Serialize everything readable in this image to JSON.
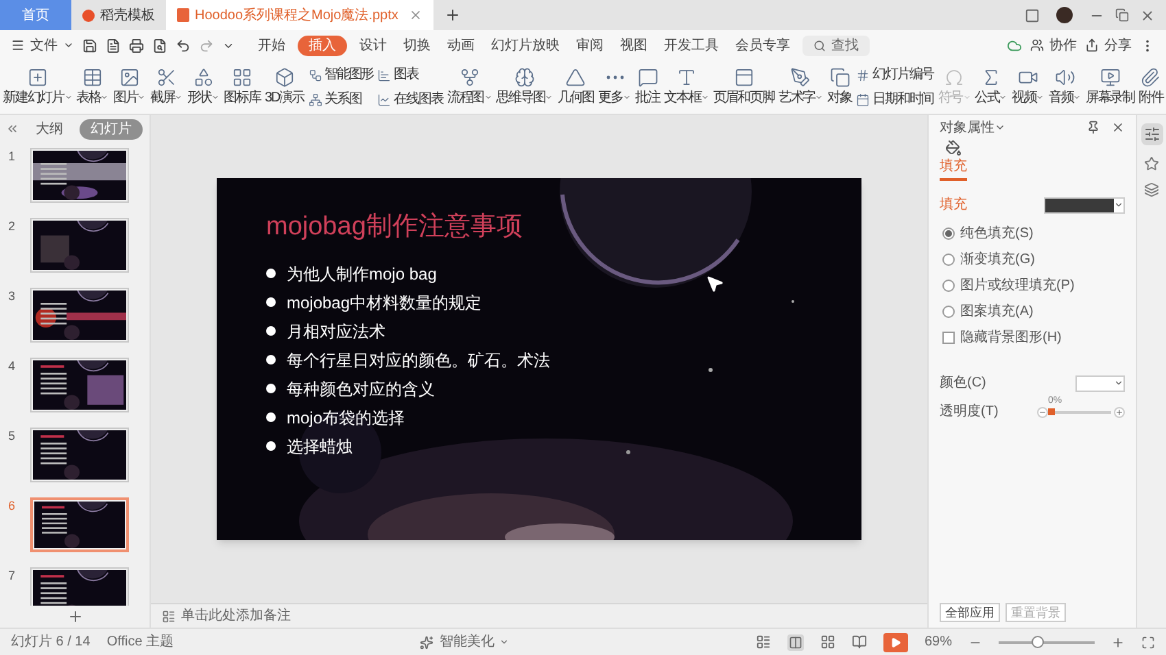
{
  "tabs": [
    {
      "label": "首页",
      "kind": "home",
      "selected": false
    },
    {
      "label": "稻壳模板",
      "kind": "template",
      "selected": false
    },
    {
      "label": "Hoodoo系列课程之Mojo魔法.pptx",
      "kind": "document",
      "selected": true
    }
  ],
  "menu": {
    "file": "文件",
    "items": [
      {
        "label": "开始",
        "selected": false
      },
      {
        "label": "插入",
        "selected": true
      },
      {
        "label": "设计",
        "selected": false
      },
      {
        "label": "切换",
        "selected": false
      },
      {
        "label": "动画",
        "selected": false
      },
      {
        "label": "幻灯片放映",
        "selected": false
      },
      {
        "label": "审阅",
        "selected": false
      },
      {
        "label": "视图",
        "selected": false
      },
      {
        "label": "开发工具",
        "selected": false
      },
      {
        "label": "会员专享",
        "selected": false
      }
    ],
    "search": "查找",
    "right": [
      "协作",
      "分享"
    ]
  },
  "ribbon": [
    {
      "kind": "large",
      "label": "新建幻灯片",
      "dropdown": true,
      "disabled": false
    },
    {
      "kind": "large",
      "label": "表格",
      "dropdown": true,
      "disabled": false
    },
    {
      "kind": "large",
      "label": "图片",
      "dropdown": true,
      "disabled": false
    },
    {
      "kind": "large",
      "label": "截屏",
      "dropdown": true,
      "disabled": false
    },
    {
      "kind": "large",
      "label": "形状",
      "dropdown": true,
      "disabled": false
    },
    {
      "kind": "large",
      "label": "图标库",
      "dropdown": false,
      "disabled": false
    },
    {
      "kind": "large",
      "label": "3D演示",
      "dropdown": false,
      "disabled": false
    },
    {
      "kind": "pair",
      "rows": [
        {
          "label": "智能图形"
        },
        {
          "label": "关系图"
        }
      ]
    },
    {
      "kind": "pair",
      "rows": [
        {
          "label": "图表"
        },
        {
          "label": "在线图表"
        }
      ]
    },
    {
      "kind": "large",
      "label": "流程图",
      "dropdown": true,
      "disabled": false
    },
    {
      "kind": "large",
      "label": "思维导图",
      "dropdown": true,
      "disabled": false
    },
    {
      "kind": "large",
      "label": "几何图",
      "dropdown": false,
      "disabled": false
    },
    {
      "kind": "large",
      "label": "更多",
      "dropdown": true,
      "disabled": false
    },
    {
      "kind": "large",
      "label": "批注",
      "dropdown": false,
      "disabled": false
    },
    {
      "kind": "large",
      "label": "文本框",
      "dropdown": true,
      "disabled": false
    },
    {
      "kind": "large",
      "label": "页眉和页脚",
      "dropdown": false,
      "disabled": false
    },
    {
      "kind": "large",
      "label": "艺术字",
      "dropdown": true,
      "disabled": false
    },
    {
      "kind": "large",
      "label": "对象",
      "dropdown": false,
      "disabled": false
    },
    {
      "kind": "pair",
      "rows": [
        {
          "label": "幻灯片编号"
        },
        {
          "label": "日期和时间"
        }
      ]
    },
    {
      "kind": "large",
      "label": "符号",
      "dropdown": true,
      "disabled": true
    },
    {
      "kind": "large",
      "label": "公式",
      "dropdown": true,
      "disabled": false
    },
    {
      "kind": "large",
      "label": "视频",
      "dropdown": true,
      "disabled": false
    },
    {
      "kind": "large",
      "label": "音频",
      "dropdown": true,
      "disabled": false
    },
    {
      "kind": "large",
      "label": "屏幕录制",
      "dropdown": false,
      "disabled": false
    },
    {
      "kind": "large",
      "label": "附件",
      "dropdown": false,
      "disabled": false
    }
  ],
  "outline_tabs": [
    {
      "label": "大纲",
      "selected": false
    },
    {
      "label": "幻灯片",
      "selected": true
    }
  ],
  "thumbnails": [
    {
      "number": "1",
      "selected": false,
      "kind": "picture"
    },
    {
      "number": "2",
      "selected": false,
      "kind": "picture"
    },
    {
      "number": "3",
      "selected": false,
      "kind": "picture"
    },
    {
      "number": "4",
      "selected": false,
      "kind": "picture"
    },
    {
      "number": "5",
      "selected": false,
      "kind": "picture"
    },
    {
      "number": "6",
      "selected": true,
      "kind": "picture"
    },
    {
      "number": "7",
      "selected": false,
      "kind": "picture"
    }
  ],
  "slide": {
    "title": "mojobag制作注意事项",
    "bullets": [
      "为他人制作mojo bag",
      "mojobag中材料数量的规定",
      "月相对应法术",
      "每个行星日对应的颜色。矿石。术法",
      "每种颜色对应的含义",
      "mojo布袋的选择",
      "选择蜡烛"
    ]
  },
  "notes_placeholder": "单击此处添加备注",
  "panel": {
    "title": "对象属性",
    "tab": "填充",
    "section": "填充",
    "options": [
      {
        "label": "纯色填充(S)",
        "kind": "radio",
        "selected": true
      },
      {
        "label": "渐变填充(G)",
        "kind": "radio",
        "selected": false
      },
      {
        "label": "图片或纹理填充(P)",
        "kind": "radio",
        "selected": false
      },
      {
        "label": "图案填充(A)",
        "kind": "radio",
        "selected": false
      },
      {
        "label": "隐藏背景图形(H)",
        "kind": "checkbox",
        "checked": false
      }
    ],
    "color_label": "颜色(C)",
    "transparency_label": "透明度(T)",
    "transparency": {
      "reading": "0%",
      "level": 0
    },
    "buttons": [
      "全部应用",
      "重置背景"
    ]
  },
  "status_bar": {
    "slide_counter": "幻灯片 6 / 14",
    "theme": "Office 主题",
    "beautify": "智能美化",
    "zoom": "69%",
    "zoom_slider": {
      "level": 0.4
    }
  }
}
